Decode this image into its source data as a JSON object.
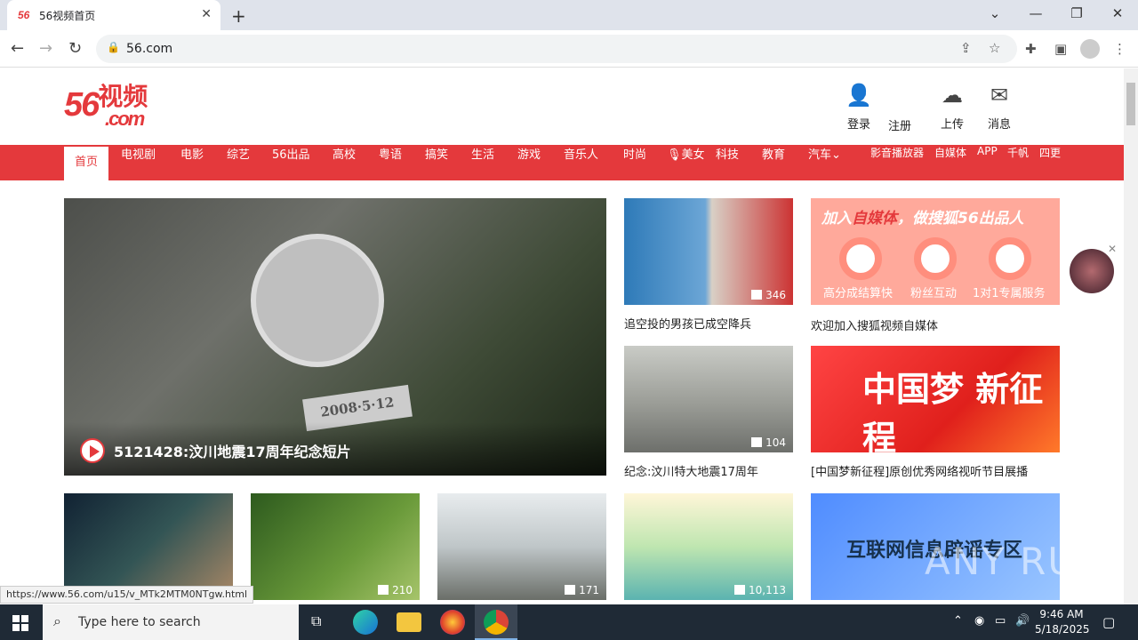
{
  "browser": {
    "tab_title": "56视频首页",
    "tab_favicon": "56",
    "url": "56.com",
    "status_url": "https://www.56.com/u15/v_MTk2MTM0NTgw.html"
  },
  "header": {
    "logo_big": "56",
    "logo_cn": "视频",
    "logo_com": ".com",
    "login": "登录",
    "register": "注册",
    "upload": "上传",
    "messages": "消息"
  },
  "nav": {
    "items": [
      "首页",
      "电视剧",
      "电影",
      "综艺",
      "56出品",
      "高校",
      "粤语",
      "搞笑",
      "生活",
      "游戏",
      "音乐人",
      "时尚",
      "美女",
      "科技",
      "教育",
      "汽车"
    ],
    "right": [
      "影音播放器",
      "自媒体",
      "APP",
      "千帆",
      "四更"
    ]
  },
  "hero": {
    "caption": "5121428:汶川地震17周年纪念短片",
    "stone_text": "2008·5·12"
  },
  "cards": [
    {
      "title": "追空投的男孩已成空降兵",
      "count": "346"
    },
    {
      "title": "纪念:汶川特大地震17周年",
      "count": "104"
    }
  ],
  "ads": {
    "ad1_head_a": "加入",
    "ad1_head_b": "自媒体",
    "ad1_head_c": "，做搜狐56出品人",
    "ad1_labels": [
      "高分成结算快",
      "粉丝互动",
      "1对1专属服务"
    ],
    "ad1_title": "欢迎加入搜狐视频自媒体",
    "ad2_main": "中国梦 新征程",
    "ad2_title": "[中国梦新征程]原创优秀网络视听节目展播",
    "ad3_main": "互联网信息辟谣专区"
  },
  "bottom_cards": [
    {
      "count": ""
    },
    {
      "count": "210"
    },
    {
      "count": "171"
    },
    {
      "count": "10,113"
    }
  ],
  "watermark": "ANY RUN",
  "taskbar": {
    "search_placeholder": "Type here to search",
    "time": "9:46 AM",
    "date": "5/18/2025"
  }
}
